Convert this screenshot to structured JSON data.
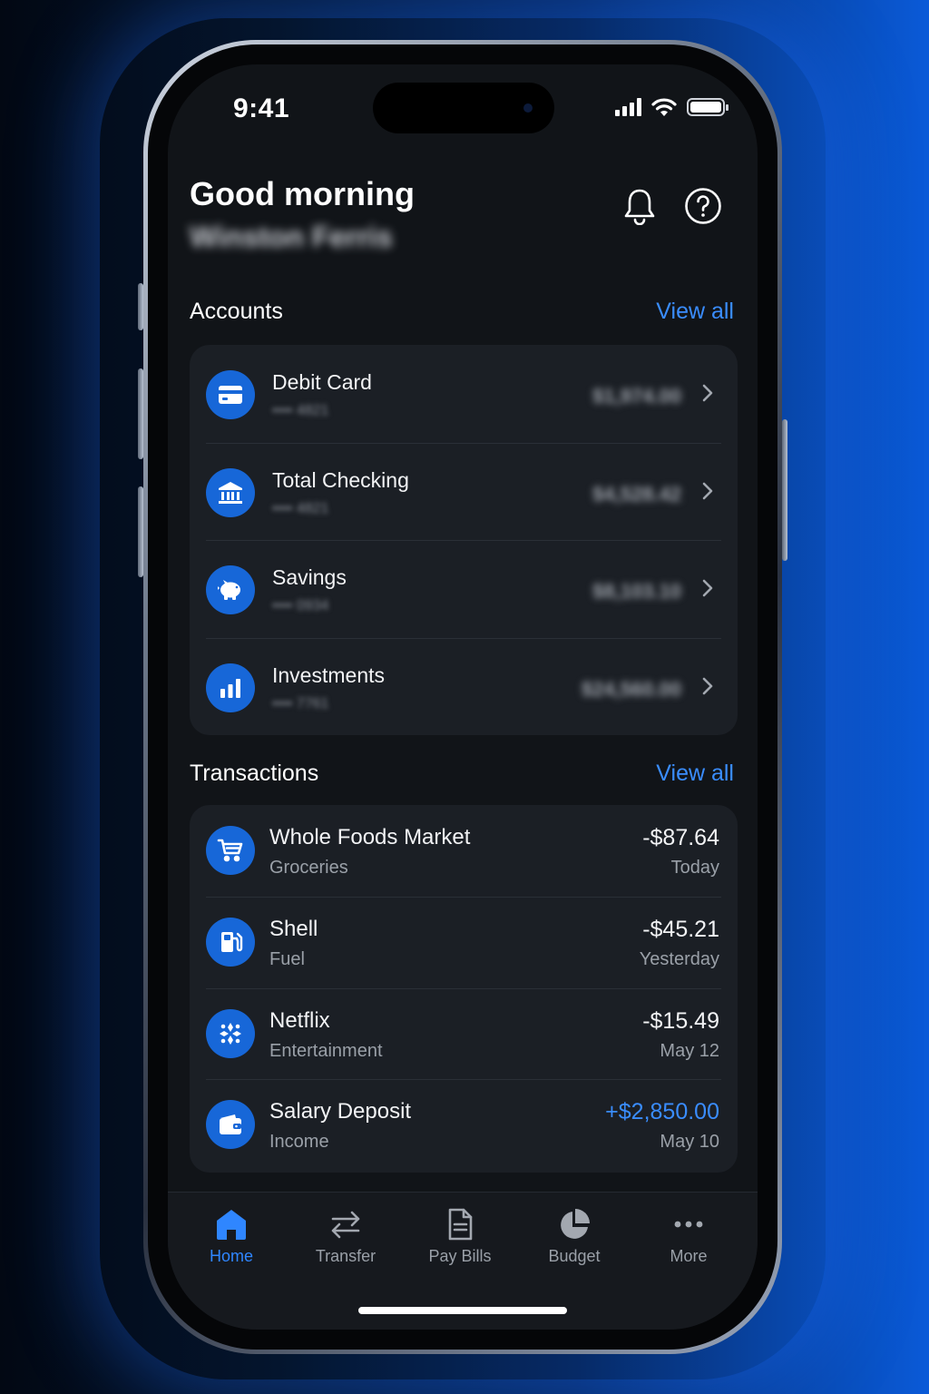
{
  "status_bar": {
    "time": "9:41"
  },
  "header": {
    "greeting": "Good morning",
    "user_name": "Winston Ferris",
    "icons": [
      "bell-icon",
      "help-circle-icon"
    ]
  },
  "accounts": {
    "title": "Accounts",
    "view_all": "View all",
    "items": [
      {
        "name": "Debit Card",
        "sub": "•••• 4821",
        "balance": "$1,974.00",
        "icon": "credit-card-icon"
      },
      {
        "name": "Total Checking",
        "sub": "•••• 4821",
        "balance": "$4,528.42",
        "icon": "bank-icon"
      },
      {
        "name": "Savings",
        "sub": "•••• 0934",
        "balance": "$8,103.10",
        "icon": "piggy-bank-icon"
      },
      {
        "name": "Investments",
        "sub": "•••• 7761",
        "balance": "$24,560.00",
        "icon": "bar-chart-icon"
      }
    ]
  },
  "transactions": {
    "title": "Transactions",
    "view_all": "View all",
    "items": [
      {
        "name": "Whole Foods Market",
        "category": "Groceries",
        "amount": "-$87.64",
        "date": "Today",
        "icon": "cart-icon"
      },
      {
        "name": "Shell",
        "category": "Fuel",
        "amount": "-$45.21",
        "date": "Yesterday",
        "icon": "fuel-icon"
      },
      {
        "name": "Netflix",
        "category": "Entertainment",
        "amount": "-$15.49",
        "date": "May 12",
        "icon": "film-icon"
      },
      {
        "name": "Salary Deposit",
        "category": "Income",
        "amount": "+$2,850.00",
        "date": "May 10",
        "icon": "wallet-icon"
      }
    ]
  },
  "tabbar": {
    "active": "Home",
    "tabs": [
      {
        "label": "Home",
        "icon": "home-icon"
      },
      {
        "label": "Transfer",
        "icon": "transfer-arrows-icon"
      },
      {
        "label": "Pay Bills",
        "icon": "bill-document-icon"
      },
      {
        "label": "Budget",
        "icon": "pie-chart-icon"
      },
      {
        "label": "More",
        "icon": "more-dots-icon"
      }
    ]
  },
  "colors": {
    "accent": "#2f86ff",
    "icon_bg": "#1767d8",
    "screen_bg": "#111418",
    "card_bg": "#1b1f25",
    "positive_amount": "#3a8dff"
  }
}
